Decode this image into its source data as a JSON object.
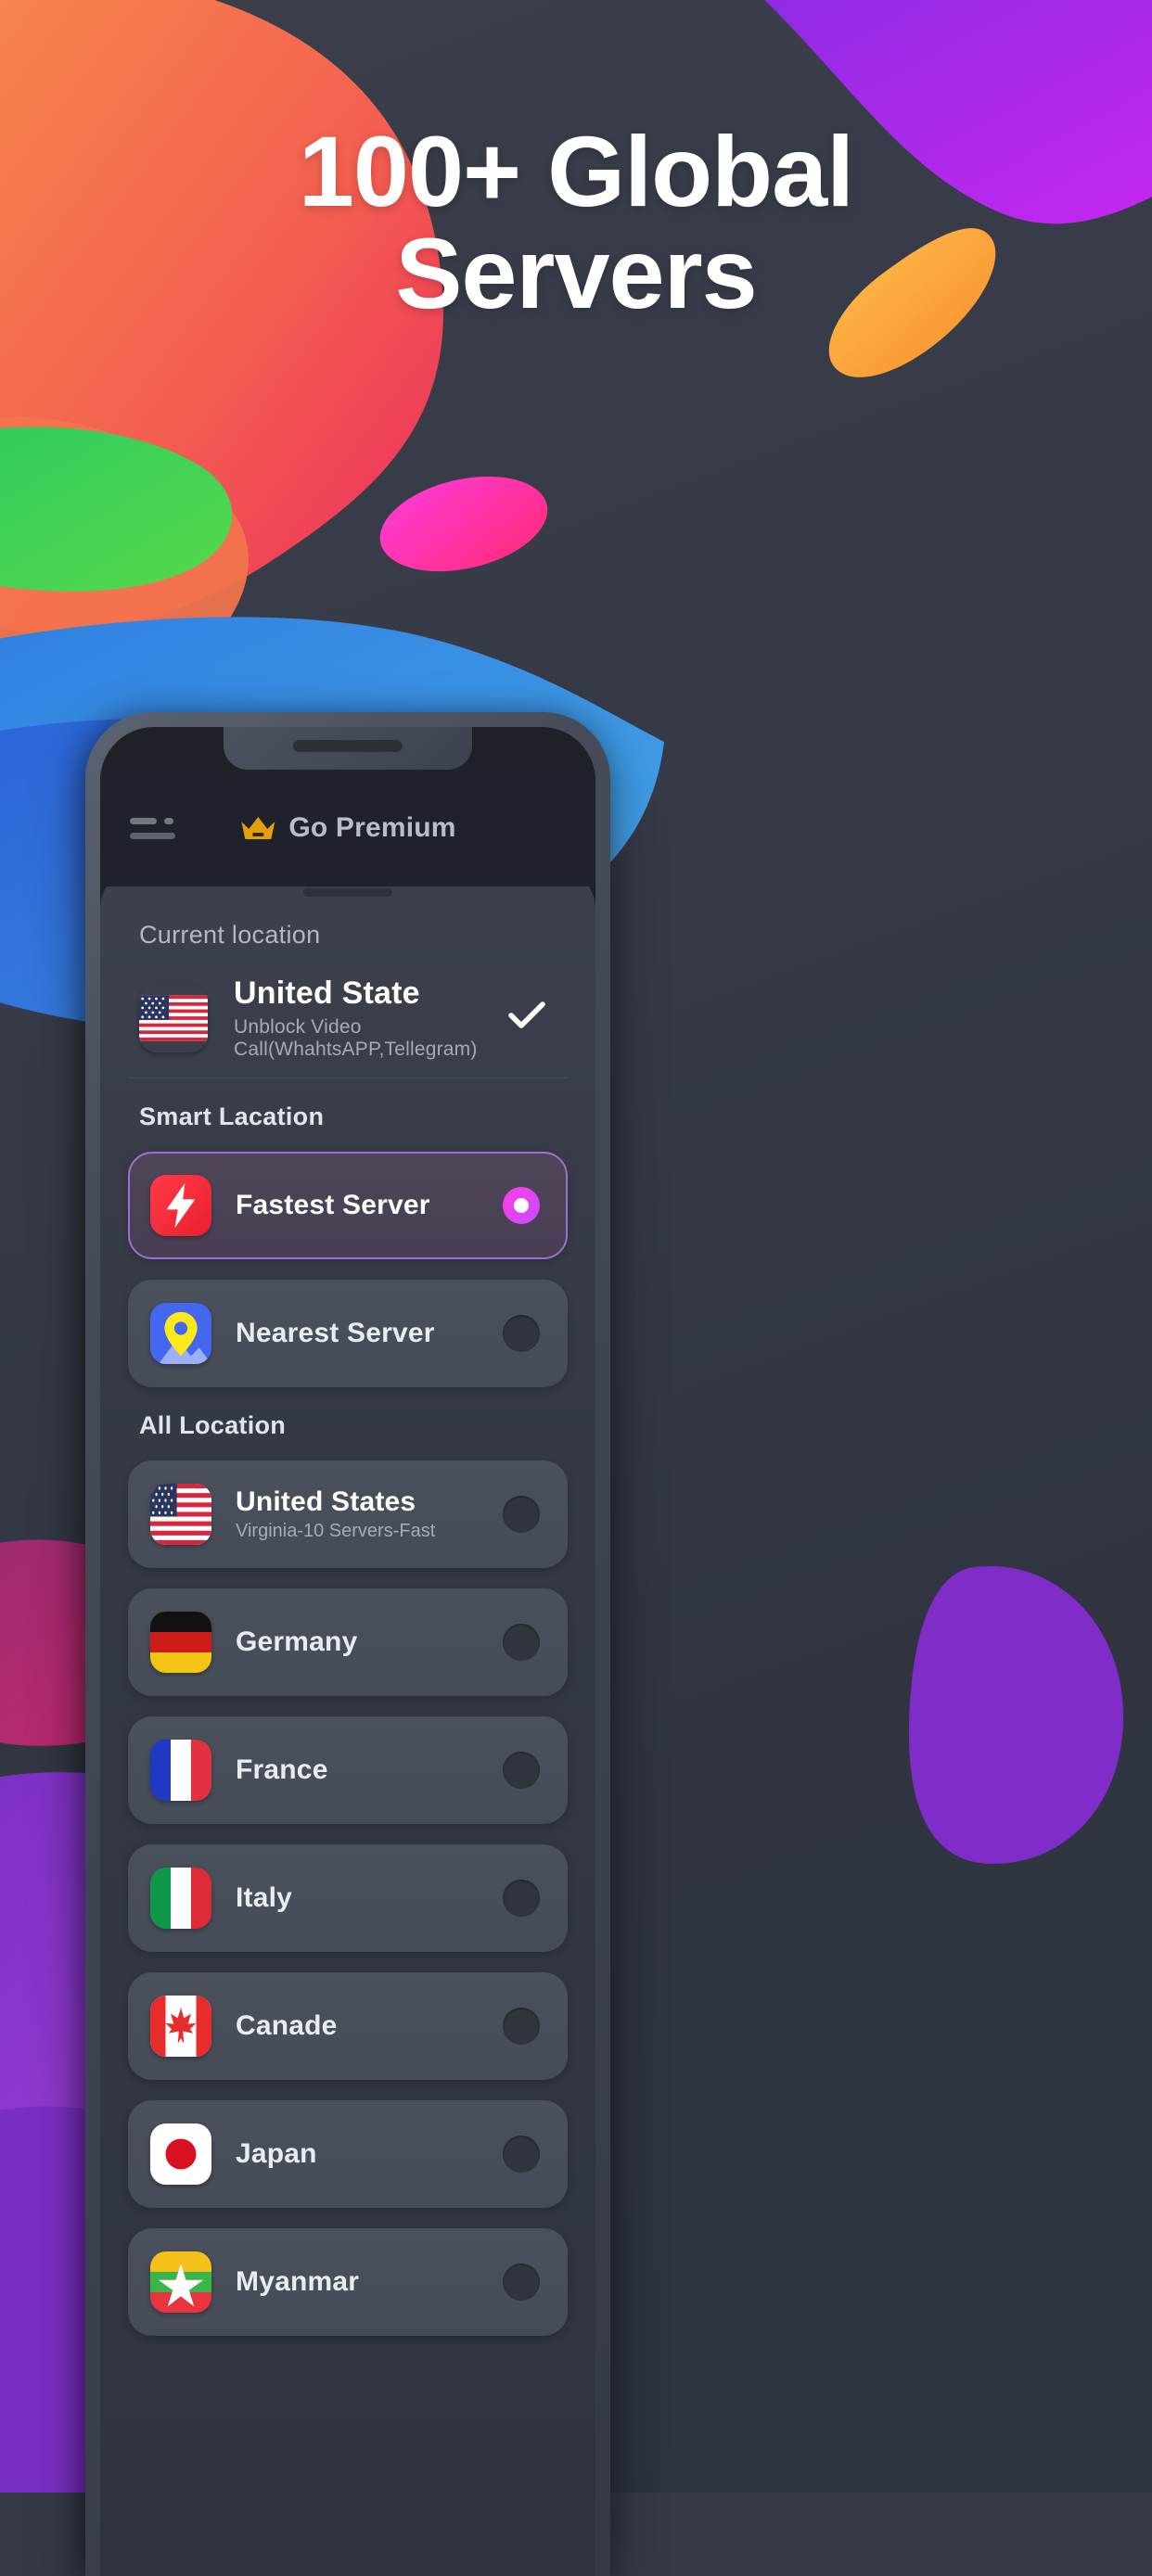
{
  "headline": {
    "line1": "100+ Global",
    "line2": "Servers"
  },
  "colors": {
    "accent_pink": "#ff3fe0",
    "accent_purple": "#c44bff",
    "highlight_border": "#9d6fd0",
    "crown_gold": "#e3a008",
    "bg_dark": "#363a47",
    "sheet_dark": "#333843",
    "row_bg": "#474d59"
  },
  "appbar": {
    "menu_icon": "hamburger-menu-icon",
    "premium_icon": "crown-icon",
    "premium_label": "Go Premium"
  },
  "sheet": {
    "current_location": {
      "section_label": "Current location",
      "flag": "us-flag-icon",
      "name": "United State",
      "subtitle": "Unblock Video Call(WhahtsAPP,Tellegram)",
      "check_icon": "check-icon",
      "selected": true
    },
    "smart_location": {
      "section_label": "Smart Lacation",
      "items": [
        {
          "icon": "lightning-bolt-icon",
          "label": "Fastest Server",
          "selected": true
        },
        {
          "icon": "map-pin-icon",
          "label": "Nearest Server",
          "selected": false
        }
      ]
    },
    "all_location": {
      "section_label": "All Location",
      "items": [
        {
          "flag": "us-flag-icon",
          "label": "United States",
          "subtitle": "Virginia-10 Servers-Fast",
          "selected": false
        },
        {
          "flag": "de-flag-icon",
          "label": "Germany",
          "subtitle": "",
          "selected": false
        },
        {
          "flag": "fr-flag-icon",
          "label": "France",
          "subtitle": "",
          "selected": false
        },
        {
          "flag": "it-flag-icon",
          "label": "Italy",
          "subtitle": "",
          "selected": false
        },
        {
          "flag": "ca-flag-icon",
          "label": "Canade",
          "subtitle": "",
          "selected": false
        },
        {
          "flag": "jp-flag-icon",
          "label": "Japan",
          "subtitle": "",
          "selected": false
        },
        {
          "flag": "mm-flag-icon",
          "label": "Myanmar",
          "subtitle": "",
          "selected": false
        }
      ]
    }
  }
}
